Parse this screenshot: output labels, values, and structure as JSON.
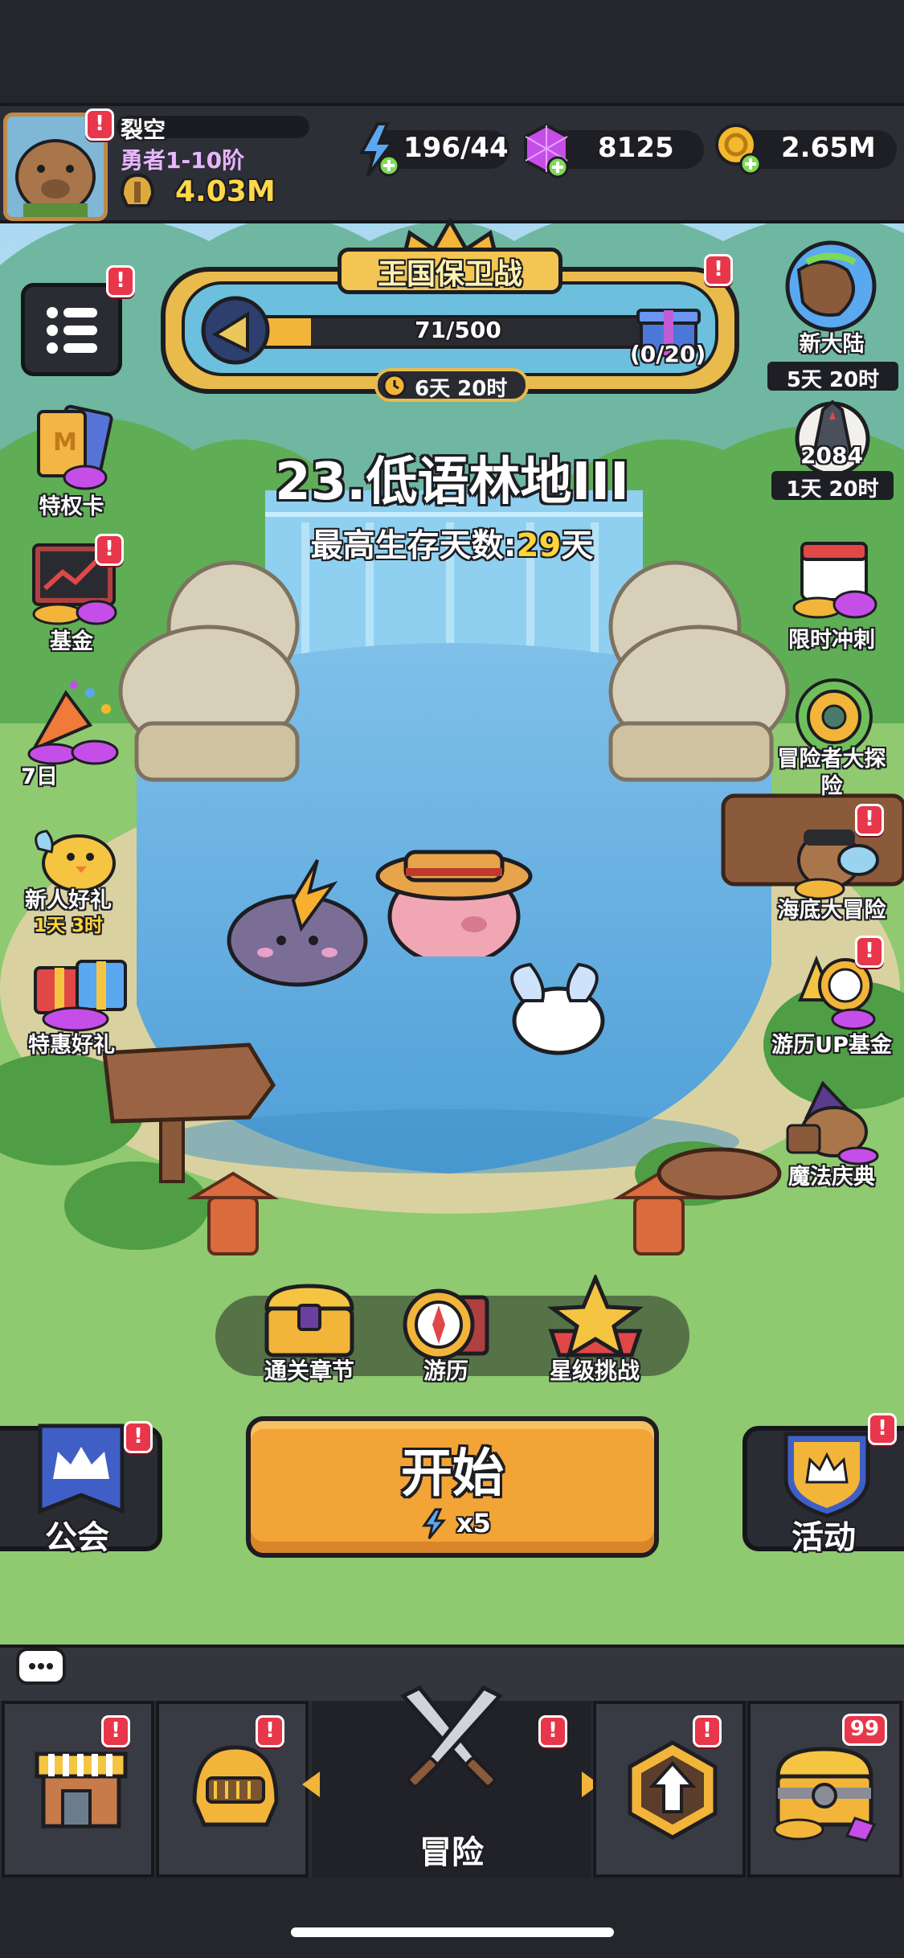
{
  "player": {
    "name": "裂空",
    "rank": "勇者1-10阶",
    "power": "4.03M"
  },
  "resources": {
    "energy": "196/44",
    "gems": "8125",
    "gold": "2.65M"
  },
  "event": {
    "title": "王国保卫战",
    "progress_text": "71/500",
    "progress_fraction": 0.142,
    "reward_count": "(0/20)",
    "timer": "6天 20时"
  },
  "stage": {
    "title": "23.低语林地III",
    "best_label": "最高生存天数:",
    "best_value": "29",
    "best_unit": "天"
  },
  "left_menu": [
    {
      "label": "特权卡"
    },
    {
      "label": "基金"
    },
    {
      "label": "7日"
    },
    {
      "label": "新人好礼",
      "timer": "1天 3时"
    },
    {
      "label": "特惠好礼"
    }
  ],
  "right_menu": [
    {
      "label": "新大陆",
      "timer": "5天 20时"
    },
    {
      "number": "2084",
      "timer": "1天 20时"
    },
    {
      "label": "限时冲刺"
    },
    {
      "label": "冒险者大探险"
    },
    {
      "label": "海底大冒险"
    },
    {
      "label": "游历UP基金"
    },
    {
      "label": "魔法庆典"
    }
  ],
  "actions": [
    {
      "label": "通关章节"
    },
    {
      "label": "游历"
    },
    {
      "label": "星级挑战"
    }
  ],
  "start": {
    "label": "开始",
    "cost": "x5"
  },
  "guild": {
    "label": "公会"
  },
  "activity": {
    "label": "活动"
  },
  "bottom_nav": {
    "center_label": "冒险",
    "chest_count": "99"
  },
  "colors": {
    "accent": "#f5a530",
    "badge": "#e8364a",
    "water": "#5aa6dd",
    "grass": "#8dc96f"
  }
}
